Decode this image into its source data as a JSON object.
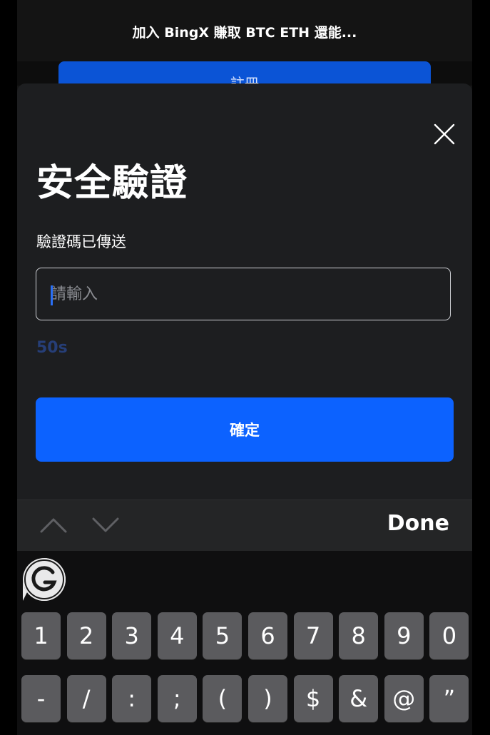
{
  "background_page": {
    "header_title": "加入 BingX 賺取 BTC ETH 還能...",
    "button_label": "註冊"
  },
  "sheet": {
    "title": "安全驗證",
    "subtitle": "驗證碼已傳送",
    "code_input": {
      "placeholder": "請輸入",
      "value": ""
    },
    "countdown": "50s",
    "confirm_label": "確定"
  },
  "accessory_bar": {
    "done_label": "Done"
  },
  "keyboard": {
    "row1": [
      "1",
      "2",
      "3",
      "4",
      "5",
      "6",
      "7",
      "8",
      "9",
      "0"
    ],
    "row2": [
      "-",
      "/",
      ":",
      ";",
      "(",
      ")",
      "$",
      "&",
      "@",
      "”"
    ]
  },
  "colors": {
    "accent": "#0c62ff",
    "sheet_bg": "#1d1e20",
    "countdown": "#263e77"
  },
  "icons": {
    "close": "close-icon",
    "prev": "chevron-up-icon",
    "next": "chevron-down-icon",
    "grammarly": "grammarly-icon"
  }
}
